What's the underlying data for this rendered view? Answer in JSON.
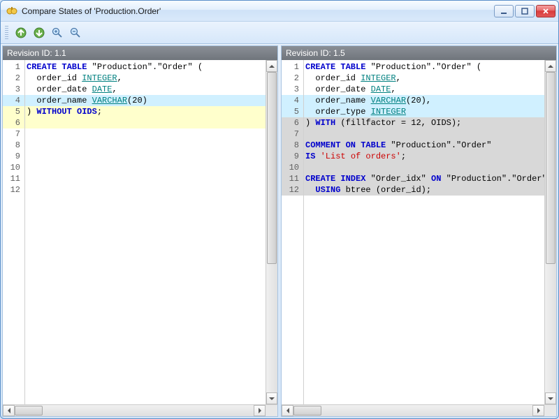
{
  "window": {
    "title": "Compare States of 'Production.Order'"
  },
  "toolbar": {
    "icons": [
      "up-arrow-icon",
      "down-arrow-icon",
      "zoom-in-icon",
      "zoom-out-icon"
    ]
  },
  "panes": {
    "left": {
      "header": "Revision ID: 1.1",
      "lines": [
        {
          "n": 1,
          "bg": "",
          "tokens": [
            {
              "t": "CREATE TABLE",
              "c": "k-blue"
            },
            {
              "t": " \"Production\".\"Order\" ("
            }
          ]
        },
        {
          "n": 2,
          "bg": "",
          "tokens": [
            {
              "t": "  order_id "
            },
            {
              "t": "INTEGER",
              "c": "k-teal"
            },
            {
              "t": ","
            }
          ]
        },
        {
          "n": 3,
          "bg": "",
          "tokens": [
            {
              "t": "  order_date "
            },
            {
              "t": "DATE",
              "c": "k-teal"
            },
            {
              "t": ","
            }
          ]
        },
        {
          "n": 4,
          "bg": "bg-cyan",
          "tokens": [
            {
              "t": "  order_name "
            },
            {
              "t": "VARCHAR",
              "c": "k-teal"
            },
            {
              "t": "(20)"
            }
          ]
        },
        {
          "n": 5,
          "bg": "bg-yellow",
          "tokens": [
            {
              "t": ") "
            },
            {
              "t": "WITHOUT OIDS",
              "c": "k-blue"
            },
            {
              "t": ";"
            }
          ]
        },
        {
          "n": 6,
          "bg": "bg-yellow",
          "tokens": [
            {
              "t": ""
            }
          ]
        },
        {
          "n": 7,
          "bg": "",
          "tokens": [
            {
              "t": ""
            }
          ]
        },
        {
          "n": 8,
          "bg": "",
          "tokens": [
            {
              "t": ""
            }
          ]
        },
        {
          "n": 9,
          "bg": "",
          "tokens": [
            {
              "t": ""
            }
          ]
        },
        {
          "n": 10,
          "bg": "",
          "tokens": [
            {
              "t": ""
            }
          ]
        },
        {
          "n": 11,
          "bg": "",
          "tokens": [
            {
              "t": ""
            }
          ]
        },
        {
          "n": 12,
          "bg": "",
          "tokens": [
            {
              "t": ""
            }
          ]
        }
      ]
    },
    "right": {
      "header": "Revision ID: 1.5",
      "lines": [
        {
          "n": 1,
          "bg": "",
          "tokens": [
            {
              "t": "CREATE TABLE",
              "c": "k-blue"
            },
            {
              "t": " \"Production\".\"Order\" ("
            }
          ]
        },
        {
          "n": 2,
          "bg": "",
          "tokens": [
            {
              "t": "  order_id "
            },
            {
              "t": "INTEGER",
              "c": "k-teal"
            },
            {
              "t": ","
            }
          ]
        },
        {
          "n": 3,
          "bg": "",
          "tokens": [
            {
              "t": "  order_date "
            },
            {
              "t": "DATE",
              "c": "k-teal"
            },
            {
              "t": ","
            }
          ]
        },
        {
          "n": 4,
          "bg": "bg-cyan",
          "tokens": [
            {
              "t": "  order_name "
            },
            {
              "t": "VARCHAR",
              "c": "k-teal"
            },
            {
              "t": "(20),"
            }
          ]
        },
        {
          "n": 5,
          "bg": "bg-cyan",
          "tokens": [
            {
              "t": "  order_type "
            },
            {
              "t": "INTEGER",
              "c": "k-teal"
            }
          ]
        },
        {
          "n": 6,
          "bg": "bg-gray",
          "tokens": [
            {
              "t": ") "
            },
            {
              "t": "WITH",
              "c": "k-blue"
            },
            {
              "t": " (fillfactor = 12, OIDS);"
            }
          ]
        },
        {
          "n": 7,
          "bg": "bg-gray",
          "tokens": [
            {
              "t": ""
            }
          ]
        },
        {
          "n": 8,
          "bg": "bg-gray",
          "tokens": [
            {
              "t": "COMMENT ON TABLE",
              "c": "k-blue"
            },
            {
              "t": " \"Production\".\"Order\""
            }
          ]
        },
        {
          "n": 9,
          "bg": "bg-gray",
          "tokens": [
            {
              "t": "IS",
              "c": "k-blue"
            },
            {
              "t": " "
            },
            {
              "t": "'List of orders'",
              "c": "k-str"
            },
            {
              "t": ";"
            }
          ]
        },
        {
          "n": 10,
          "bg": "bg-gray",
          "tokens": [
            {
              "t": ""
            }
          ]
        },
        {
          "n": 11,
          "bg": "bg-gray",
          "tokens": [
            {
              "t": "CREATE INDEX",
              "c": "k-blue"
            },
            {
              "t": " \"Order_idx\" "
            },
            {
              "t": "ON",
              "c": "k-blue"
            },
            {
              "t": " \"Production\".\"Order\""
            }
          ]
        },
        {
          "n": 12,
          "bg": "bg-gray",
          "tokens": [
            {
              "t": "  "
            },
            {
              "t": "USING",
              "c": "k-blue"
            },
            {
              "t": " btree (order_id);"
            }
          ]
        }
      ]
    }
  }
}
